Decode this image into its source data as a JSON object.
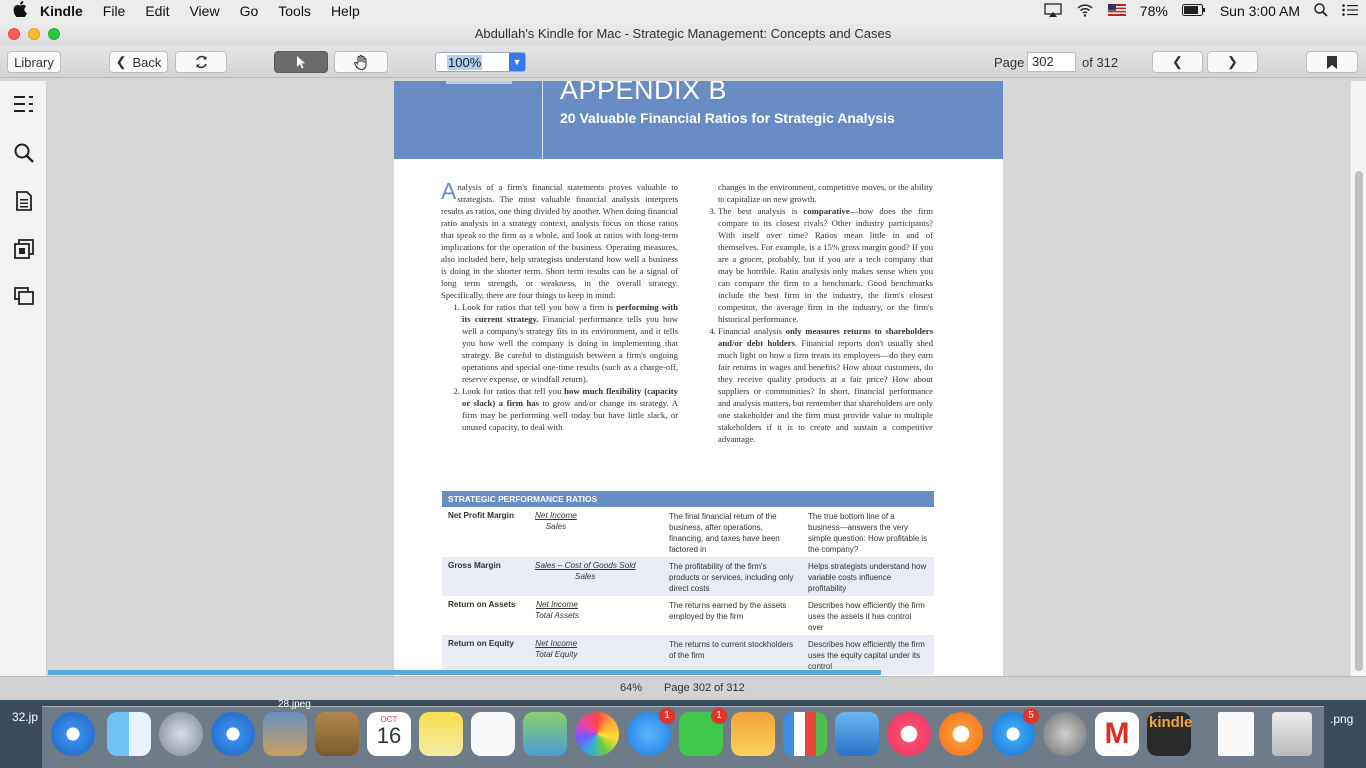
{
  "menubar": {
    "app_name": "Kindle",
    "items": [
      "File",
      "Edit",
      "View",
      "Go",
      "Tools",
      "Help"
    ],
    "battery": "78%",
    "clock": "Sun 3:00 AM"
  },
  "window": {
    "title": "Abdullah's Kindle for Mac - Strategic Management: Concepts and Cases"
  },
  "toolbar": {
    "library": "Library",
    "back": "Back",
    "zoom": "100%",
    "page_label": "Page",
    "page_value": "302",
    "page_total": "of 312"
  },
  "book": {
    "appendix": "APPENDIX B",
    "subtitle": "20 Valuable Financial Ratios for Strategic Analysis",
    "dropcap": "A",
    "intro": "nalysis of a firm's financial statements proves valuable to strategists. The most valuable financial analysis interprets results as ratios, one thing divided by another. When doing financial ratio analysis in a strategy context, analysts focus on those ratios that speak to the firm as a whole, and look at ratios with long-term implications for the operation of the business. Operating measures, also included here, help strategists understand how well a business is doing in the shorter term. Short term results can be a signal of long term strength, or weakness, in the overall strategy. Specifically, there are four things to keep in mind:",
    "item1_a": "Look for ratios that tell you how a firm is ",
    "item1_b": "performing with its current strategy.",
    "item1_c": " Financial performance tells you how well a company's strategy fits in its environment, and it tells you how well the company is doing in implementing that strategy. Be careful to distinguish between a firm's ongoing operations and special one-time results (such as a charge-off, reserve expense, or windfall return).",
    "item2_a": "Look for ratios that tell you ",
    "item2_b": "how much flexibility (capacity or slack) a firm has",
    "item2_c": " to grow and/or change its strategy. A firm may be performing well today but have little slack, or unused capacity, to deal with",
    "col2_cont": "changes in the environment, competitive moves, or the ability to capitalize on new growth.",
    "item3_a": "The best analysis is ",
    "item3_b": "comparative",
    "item3_c": "—how does the firm compare to its closest rivals? Other industry participants? With itself over time? Ratios mean little in and of themselves. For example, is a 15% gross margin good? If you are a grocer, probably, but if you are a tech company that may be horrible. Ratio analysis only makes sense when you can compare the firm to a benchmark. Good benchmarks include the best firm in the industry, the firm's closest competitor, the average firm in the industry, or the firm's historical performance.",
    "item4_a": "Financial analysis ",
    "item4_b": "only measures returns to shareholders and/or debt holders",
    "item4_c": ". Financial reports don't usually shed much light on how a firm treats its employees—do they earn fair returns in wages and benefits? How about customers, do they receive quality products at a fair price? How about suppliers or communities? In short, financial performance and analysis matters, but remember that shareholders are only one stakeholder and the firm must provide value to multiple stakeholders if it is to create and sustain a competitive advantage.",
    "table_header": "STRATEGIC PERFORMANCE RATIOS",
    "ratios": [
      {
        "name": "Net Profit Margin",
        "num": "Net Income",
        "den": "Sales",
        "desc": "The final financial return of the business, after operations, financing, and taxes have been factored in",
        "why": "The true bottom line of a business—answers the very simple question: How profitable is the company?"
      },
      {
        "name": "Gross Margin",
        "num": "Sales – Cost of Goods Sold",
        "den": "Sales",
        "desc": "The profitability of the firm's products or services, including only direct costs",
        "why": "Helps strategists understand how variable costs influence profitability"
      },
      {
        "name": "Return on Assets",
        "num": "Net Income",
        "den": "Total Assets",
        "desc": "The returns earned by the assets employed by the firm",
        "why": "Describes how efficiently the firm uses the assets it has control over"
      },
      {
        "name": "Return on Equity",
        "num": "Net Income",
        "den": "Total Equity",
        "desc": "The returns to current stockholders of the firm",
        "why": "Describes how efficiently the firm uses the equity capital under its control"
      }
    ]
  },
  "status": {
    "percent": "64%",
    "page": "Page 302 of 312",
    "progress": 0.64
  },
  "dock": {
    "left_label": "32.jp",
    "top_label": "28.jpeg",
    "right_label": ".png",
    "calendar_month": "OCT",
    "calendar_day": "16",
    "messages_badge": "1",
    "facetime_badge": "1",
    "appstore_badge": "5",
    "kindle_label": "kindle"
  },
  "colors": {
    "banner": "#6a8cc4",
    "accent": "#3478f6",
    "progress": "#5aa8d8"
  }
}
